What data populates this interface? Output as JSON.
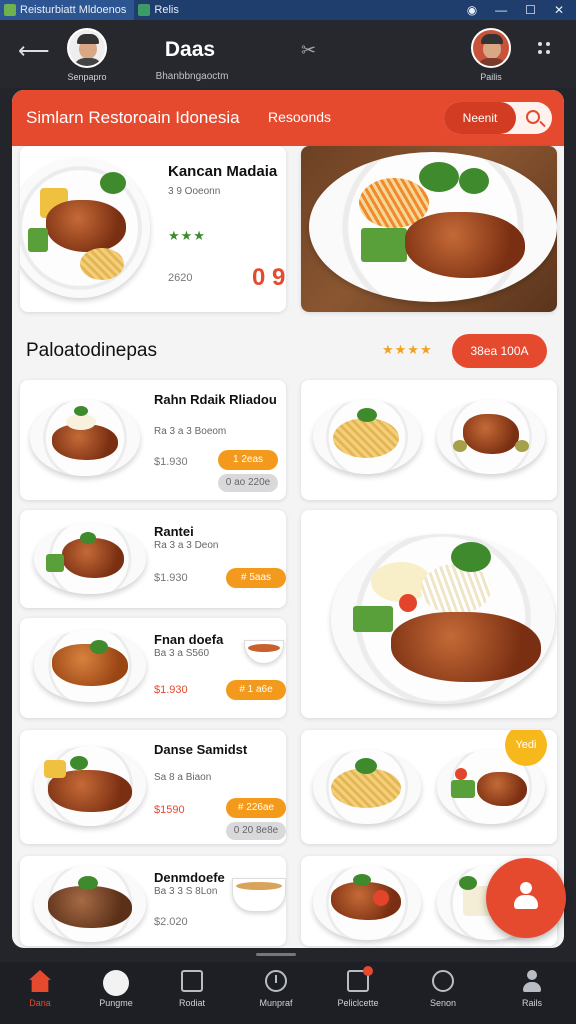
{
  "window": {
    "tab1": "Reisturbiatt Mldoenos",
    "tab2": "Relis"
  },
  "header": {
    "title": "Daas",
    "subtitle": "Bhanbbngaoctm",
    "left_user": "Senpapro",
    "right_user": "Pailis"
  },
  "redbar": {
    "title": "Simlarn Restoroain Idonesia",
    "link": "Resoonds",
    "search_button": "Neenit"
  },
  "featured": {
    "name": "Kancan Madaia",
    "sub": "3 9 Ooeonn",
    "stars": "★★★",
    "price": "2620",
    "count": "0 9"
  },
  "section": {
    "title": "Paloatodinepas",
    "stars": "★★★★",
    "button": "38ea 100A"
  },
  "menu_items": [
    {
      "name": "Rahn Rdaik Rliadou",
      "sub": "Ra 3 a 3 Boeom",
      "price": "$1.930",
      "pill": "1 2eas",
      "pill2": "0 ao 220e"
    },
    {
      "name": "Rantei",
      "sub": "Ra 3 a 3 Deon",
      "price": "$1.930",
      "pill": "# 5aas",
      "pill2": ""
    },
    {
      "name": "Fnan doefa",
      "sub": "Ba 3 a S560",
      "price": "$1.930",
      "pill": "# 1 a6e",
      "pill2": ""
    },
    {
      "name": "Danse Samidst",
      "sub": "Sa 8 a Biaon",
      "price": "$1590",
      "pill": "# 226ae",
      "pill2": "0 20 8e8e"
    },
    {
      "name": "Denmdoefe",
      "sub": "Ba 3 3 S 8Lon",
      "price": "$2.020",
      "pill": "",
      "pill2": ""
    }
  ],
  "badge": "Yedi",
  "nav": [
    {
      "label": "Dana",
      "icon": "home-icon"
    },
    {
      "label": "Pungme",
      "icon": "mascot-icon"
    },
    {
      "label": "Rodiat",
      "icon": "box-icon"
    },
    {
      "label": "Munpraf",
      "icon": "clock-icon"
    },
    {
      "label": "Peliclcette",
      "icon": "notification-icon"
    },
    {
      "label": "Senon",
      "icon": "globe-icon"
    },
    {
      "label": "Rails",
      "icon": "user-icon"
    }
  ],
  "colors": {
    "brand": "#e64a2e",
    "accent": "#f39a1c",
    "background": "#23252b"
  }
}
